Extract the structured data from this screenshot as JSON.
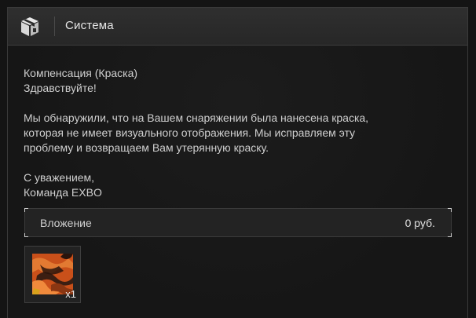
{
  "header": {
    "title": "Система",
    "icon": "box-icon"
  },
  "message": {
    "subject": "Компенсация (Краска)",
    "greeting": "Здравствуйте!",
    "body_line1": "Мы обнаружили, что на Вашем снаряжении была нанесена краска,",
    "body_line2": "которая не имеет визуального отображения. Мы исправляем эту",
    "body_line3": "проблему и возвращаем Вам утерянную краску.",
    "signoff": "С уважением,",
    "signature": "Команда EXBO"
  },
  "attachment": {
    "label": "Вложение",
    "price": "0 руб."
  },
  "item": {
    "count": "x1",
    "icon": "paint-icon"
  },
  "colors": {
    "background": "#141414",
    "header": "#2c2c2c",
    "text": "#cfcfcf",
    "paint_orange": "#d35a1e"
  }
}
